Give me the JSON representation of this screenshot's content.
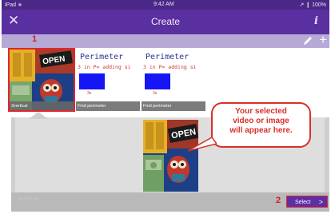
{
  "status_bar": {
    "carrier": "iPad ∗",
    "time": "9:42 AM",
    "battery": "↗ ❙ 100%"
  },
  "nav": {
    "title": "Create",
    "close_icon": "✕",
    "info_icon": "i"
  },
  "toolbar": {
    "pencil_icon": "pencil-icon",
    "plus_icon": "+"
  },
  "thumbnails": [
    {
      "caption": "3vertical",
      "selected": true,
      "kind": "photo"
    },
    {
      "caption": "Find perimeter",
      "selected": false,
      "kind": "drawing",
      "heading": "Perimeter",
      "formula": "3 in P= adding si",
      "dim": "3s"
    },
    {
      "caption": "Find perimeter",
      "selected": false,
      "kind": "drawing",
      "heading": "Perimeter",
      "formula": "3 in P= adding si",
      "dim": "3s"
    }
  ],
  "annotations": {
    "step1": "1",
    "step2": "2"
  },
  "callout": {
    "line1": "Your selected",
    "line2": "video or image",
    "line3": "will appear here."
  },
  "bottom": {
    "ghost_label": "3vertical",
    "select_label": "Select",
    "select_chevron": ">"
  },
  "colors": {
    "header": "#5a2fa0",
    "status": "#4b2887",
    "toolbar": "#b7a9d6",
    "accent": "#e0272c",
    "button": "#5c2fa3"
  }
}
